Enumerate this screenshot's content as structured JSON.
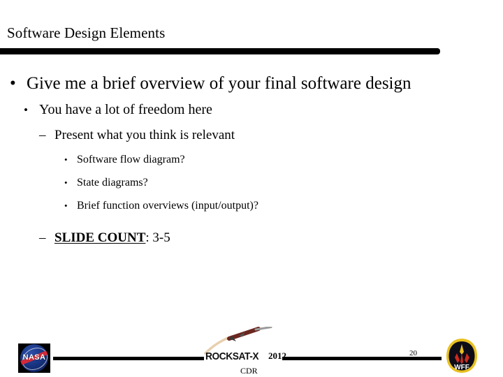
{
  "slide": {
    "title": "Software Design Elements",
    "page_number": "20",
    "background_color": "#ffffff",
    "rule_color": "#000000"
  },
  "content": {
    "bullets": [
      {
        "level": 1,
        "marker": "•",
        "text": "Give me a brief overview of your final software design"
      },
      {
        "level": 2,
        "marker": "•",
        "text": "You have a lot of freedom here"
      },
      {
        "level": 3,
        "marker": "–",
        "text": "Present what you think is relevant"
      },
      {
        "level": 4,
        "marker": "•",
        "text": "Software flow diagram?"
      },
      {
        "level": 4,
        "marker": "•",
        "text": "State diagrams?"
      },
      {
        "level": 4,
        "marker": "•",
        "text": "Brief function overviews (input/output)?"
      }
    ],
    "slide_count_line": {
      "marker": "–",
      "emphasis": "SLIDE COUNT",
      "rest": ": 3-5"
    }
  },
  "footer": {
    "nasa_logo_text": "NASA",
    "rocksat_word": "ROCKSAT-X",
    "rocksat_year": "2012",
    "rocksat_review": "CDR",
    "wff_logo_text": "WFF",
    "colors": {
      "nasa_blue": "#16307a",
      "nasa_red": "#d4293a",
      "rocket_body": "#6b2720",
      "rocket_trail": "#e8cfae",
      "wff_border": "#e8c020",
      "wff_field": "#0d0d18",
      "wff_flame": "#cc2b1e"
    }
  }
}
